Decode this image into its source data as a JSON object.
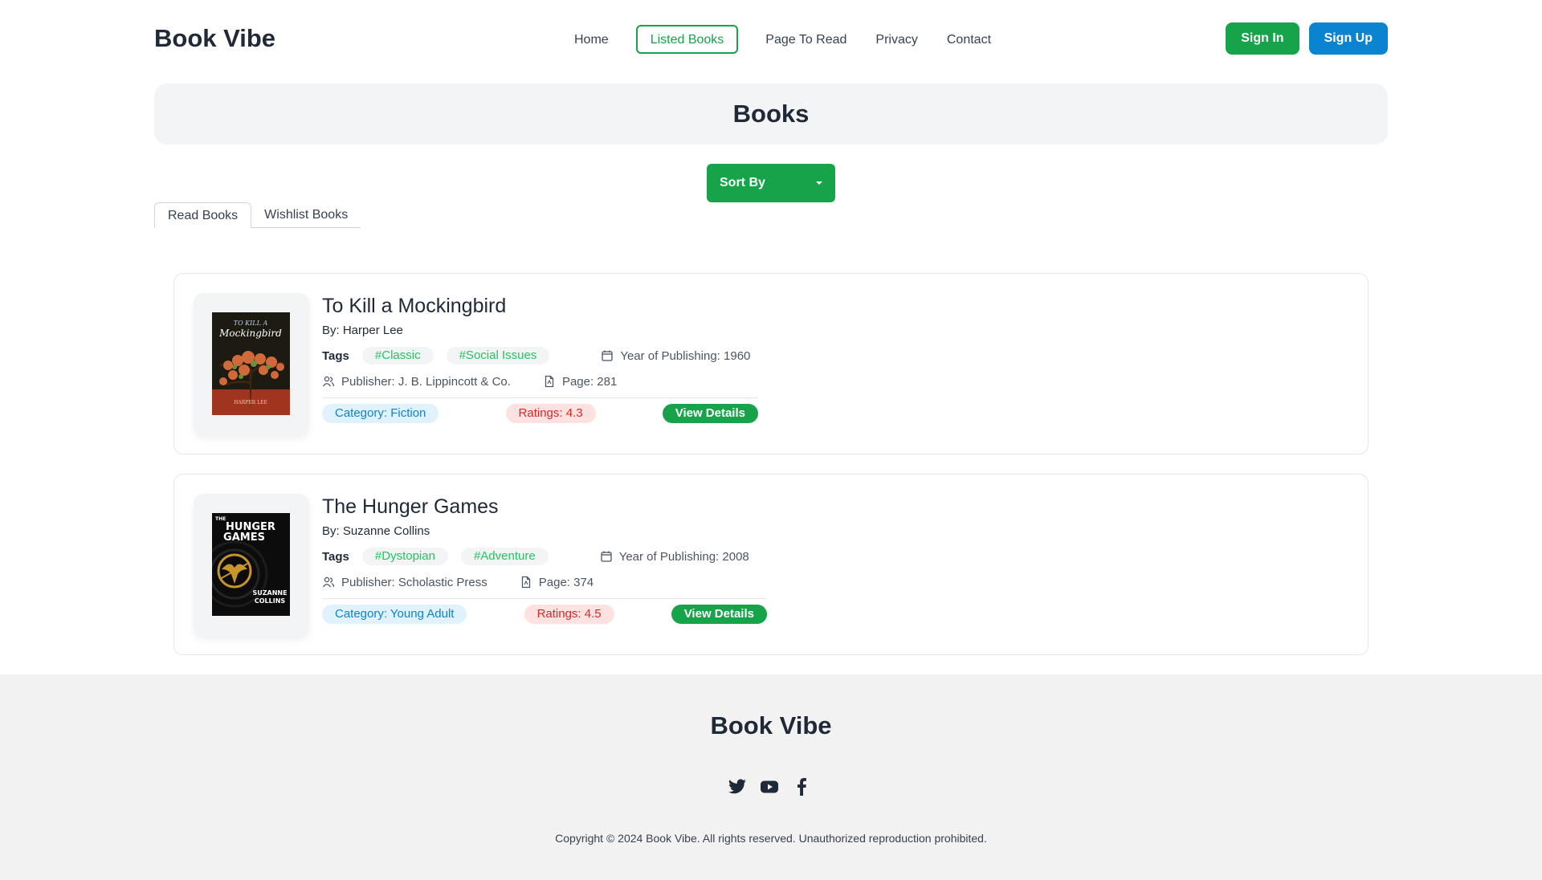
{
  "brand": "Book Vibe",
  "nav": {
    "links": [
      "Home",
      "Listed Books",
      "Page To Read",
      "Privacy",
      "Contact"
    ],
    "active": "Listed Books",
    "sign_in": "Sign In",
    "sign_up": "Sign Up"
  },
  "banner_title": "Books",
  "sort_label": "Sort By",
  "tabs": [
    "Read Books",
    "Wishlist Books"
  ],
  "active_tab": "Read Books",
  "tags_label": "Tags",
  "books": [
    {
      "title": "To Kill a Mockingbird",
      "author": "By: Harper Lee",
      "tags": [
        "#Classic",
        "#Social Issues"
      ],
      "year": "Year of Publishing: 1960",
      "publisher": "Publisher: J. B. Lippincott & Co.",
      "pages": "Page: 281",
      "category": "Category: Fiction",
      "rating": "Ratings: 4.3",
      "details": "View Details",
      "cover_lines": [
        "TO KILL A",
        "Mockingbird",
        "HARPER LEE"
      ]
    },
    {
      "title": "The Hunger Games",
      "author": "By: Suzanne Collins",
      "tags": [
        "#Dystopian",
        "#Adventure"
      ],
      "year": "Year of Publishing: 2008",
      "publisher": "Publisher: Scholastic Press",
      "pages": "Page: 374",
      "category": "Category: Young Adult",
      "rating": "Ratings: 4.5",
      "details": "View Details",
      "cover_lines": [
        "THE",
        "HUNGER",
        "GAMES",
        "SUZANNE",
        "COLLINS"
      ]
    }
  ],
  "footer": {
    "brand": "Book Vibe",
    "socials": [
      "twitter-icon",
      "youtube-icon",
      "facebook-icon"
    ],
    "copyright": "Copyright © 2024 Book Vibe. All rights reserved. Unauthorized reproduction prohibited."
  },
  "colors": {
    "green": "#16a34a",
    "blue": "#0b84d0",
    "tag_text": "#22c55e",
    "rating": "#dc2626"
  }
}
